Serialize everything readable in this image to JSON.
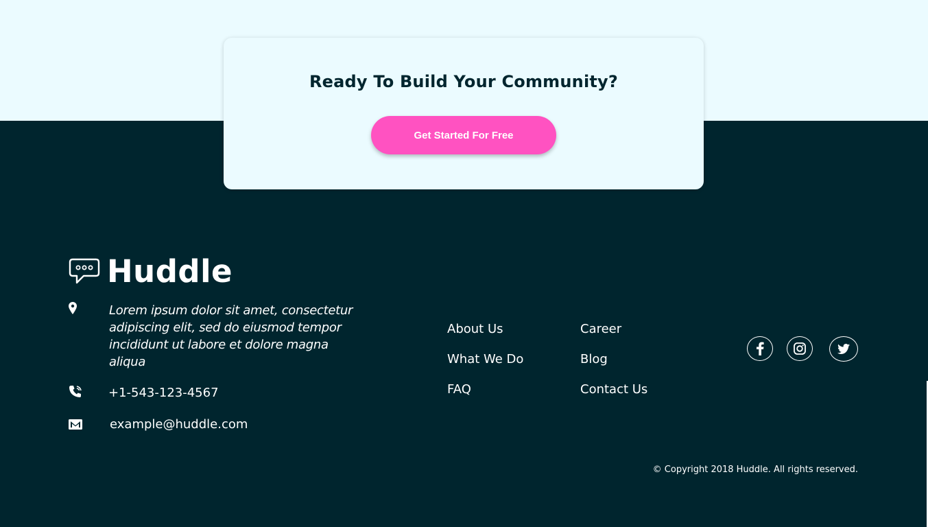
{
  "cta": {
    "title": "Ready To Build Your Community?",
    "button_label": "Get Started For Free"
  },
  "brand": {
    "name": "Huddle",
    "logo_icon": "chat-bubble-icon"
  },
  "contact": {
    "address": "Lorem ipsum dolor sit amet, consectetur adipiscing elit, sed do eiusmod tempor incididunt ut labore et dolore magna aliqua",
    "phone": "+1-543-123-4567",
    "email": "example@huddle.com",
    "icons": [
      "location-pin-icon",
      "phone-icon",
      "mail-icon"
    ]
  },
  "nav": {
    "col1": [
      "About Us",
      "What We Do",
      "FAQ"
    ],
    "col2": [
      "Career",
      "Blog",
      "Contact Us"
    ]
  },
  "social": [
    "facebook-icon",
    "instagram-icon",
    "twitter-icon"
  ],
  "copyright": "© Copyright 2018 Huddle. All rights reserved.",
  "colors": {
    "light_bg": "#ebfbff",
    "dark_bg": "#00252e",
    "accent": "#ff52c1",
    "text_light": "#ffffff"
  }
}
